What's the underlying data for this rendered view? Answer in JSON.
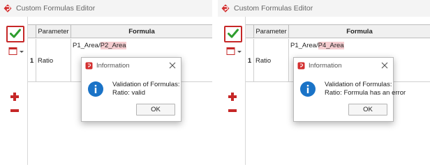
{
  "panels": [
    {
      "window_title": "Custom Formulas Editor",
      "columns": {
        "parameter": "Parameter",
        "formula": "Formula"
      },
      "row": {
        "number": "1",
        "parameter": "Ratio",
        "formula_prefix": "P1_Area/",
        "formula_highlight": "P2_Area"
      },
      "dialog": {
        "title": "Information",
        "message_line1": "Validation of Formulas:",
        "message_line2": "Ratio: valid",
        "ok_label": "OK"
      }
    },
    {
      "window_title": "Custom Formulas Editor",
      "columns": {
        "parameter": "Parameter",
        "formula": "Formula"
      },
      "row": {
        "number": "1",
        "parameter": "Ratio",
        "formula_prefix": "P1_Area/",
        "formula_highlight": "P4_Area"
      },
      "dialog": {
        "title": "Information",
        "message_line1": "Validation of Formulas:",
        "message_line2": "Ratio: Formula has an error",
        "ok_label": "OK"
      }
    }
  ],
  "icons": {
    "app": "app-logo-icon",
    "apply": "checkmark-icon",
    "form": "form-dropdown-icon",
    "add": "plus-icon",
    "remove": "minus-icon",
    "info": "info-icon",
    "close": "close-icon"
  },
  "colors": {
    "accent_red": "#c62828",
    "check_green": "#2e9d2e",
    "info_blue": "#1a73c7",
    "highlight_pink": "#f5cdd0"
  }
}
